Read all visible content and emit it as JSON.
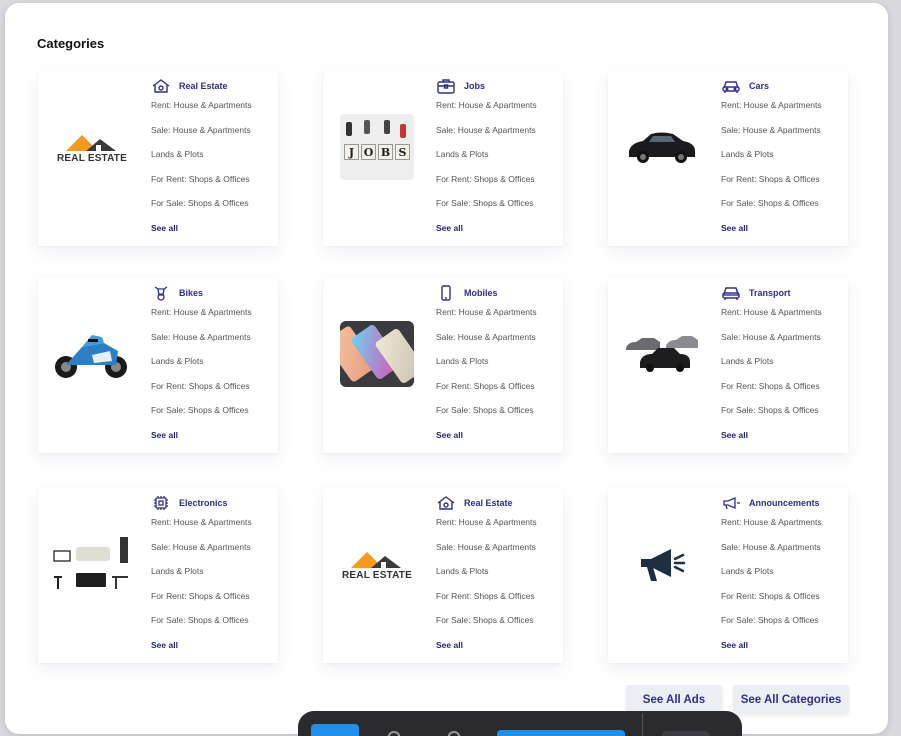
{
  "page_title": "Categories",
  "accent_color": "#2e2f8f",
  "categories": [
    {
      "name": "Real Estate",
      "icon": "house-icon",
      "thumb": "real-estate-logo",
      "logo_text": "REAL ESTATE",
      "links": [
        "Rent: House & Apartments",
        "Sale: House & Apartments",
        "Lands & Plots",
        "For Rent: Shops & Offices",
        "For Sale: Shops & Offices"
      ],
      "see_all": "See all"
    },
    {
      "name": "Jobs",
      "icon": "briefcase-icon",
      "thumb": "jobs-image",
      "logo_text": "JOBS",
      "links": [
        "Rent: House & Apartments",
        "Sale: House & Apartments",
        "Lands & Plots",
        "For Rent: Shops & Offices",
        "For Sale: Shops & Offices"
      ],
      "see_all": "See all"
    },
    {
      "name": "Cars",
      "icon": "car-icon",
      "thumb": "car-image",
      "links": [
        "Rent: House & Apartments",
        "Sale: House & Apartments",
        "Lands & Plots",
        "For Rent: Shops & Offices",
        "For Sale: Shops & Offices"
      ],
      "see_all": "See all"
    },
    {
      "name": "Bikes",
      "icon": "bike-icon",
      "thumb": "motorcycle-image",
      "links": [
        "Rent: House & Apartments",
        "Sale: House & Apartments",
        "Lands & Plots",
        "For Rent: Shops & Offices",
        "For Sale: Shops & Offices"
      ],
      "see_all": "See all"
    },
    {
      "name": "Mobiles",
      "icon": "mobile-icon",
      "thumb": "mobiles-image",
      "links": [
        "Rent: House & Apartments",
        "Sale: House & Apartments",
        "Lands & Plots",
        "For Rent: Shops & Offices",
        "For Sale: Shops & Offices"
      ],
      "see_all": "See all"
    },
    {
      "name": "Transport",
      "icon": "transport-icon",
      "thumb": "transport-image",
      "links": [
        "Rent: House & Apartments",
        "Sale: House & Apartments",
        "Lands & Plots",
        "For Rent: Shops & Offices",
        "For Sale: Shops & Offices"
      ],
      "see_all": "See all"
    },
    {
      "name": "Electronics",
      "icon": "chip-icon",
      "thumb": "furniture-image",
      "links": [
        "Rent: House & Apartments",
        "Sale: House & Apartments",
        "Lands & Plots",
        "For Rent: Shops & Offices",
        "For Sale: Shops & Offices"
      ],
      "see_all": "See all"
    },
    {
      "name": "Real Estate",
      "icon": "house-icon",
      "thumb": "real-estate-logo",
      "logo_text": "REAL ESTATE",
      "links": [
        "Rent: House & Apartments",
        "Sale: House & Apartments",
        "Lands & Plots",
        "For Rent: Shops & Offices",
        "For Sale: Shops & Offices"
      ],
      "see_all": "See all"
    },
    {
      "name": "Announcements",
      "icon": "megaphone-icon",
      "thumb": "megaphone-image",
      "links": [
        "Rent: House & Apartments",
        "Sale: House & Apartments",
        "Lands & Plots",
        "For Rent: Shops & Offices",
        "For Sale: Shops & Offices"
      ],
      "see_all": "See all"
    }
  ],
  "actions": {
    "see_all_ads": "See All Ads",
    "see_all_categories": "See All Categories"
  }
}
